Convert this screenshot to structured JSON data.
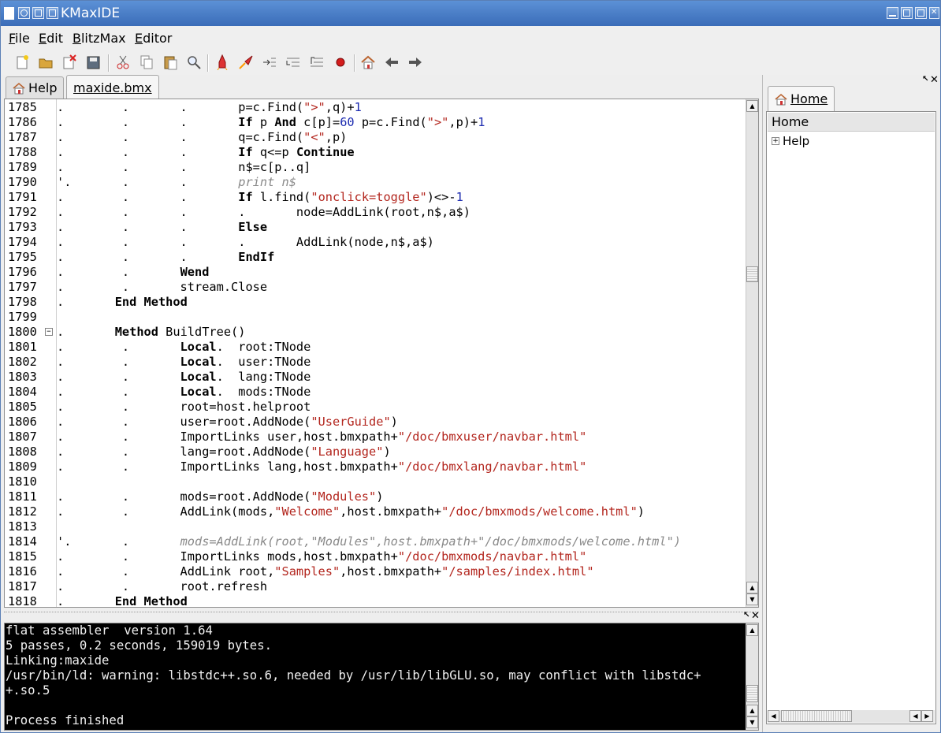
{
  "window": {
    "title": "KMaxIDE"
  },
  "menu": [
    "File",
    "Edit",
    "BlitzMax",
    "Editor"
  ],
  "menu_mnemonic": [
    "F",
    "E",
    "B",
    "E"
  ],
  "toolbar": {
    "icons": [
      "new-file-icon",
      "open-file-icon",
      "close-file-icon",
      "save-file-icon",
      "cut-icon",
      "copy-icon",
      "paste-icon",
      "find-icon",
      "build-icon",
      "build-run-icon",
      "step-icon",
      "step-in-icon",
      "step-out-icon",
      "stop-icon",
      "home-icon",
      "back-icon",
      "forward-icon"
    ]
  },
  "tabs": [
    {
      "label": "Help",
      "icon": "home-icon"
    },
    {
      "label": "maxide.bmx"
    }
  ],
  "editor": {
    "lines": [
      {
        "n": "1785",
        "html": "<span>.        .       .       p=c.Find(<span class='str'>\">\"</span>,q)+<span class='num'>1</span></span>"
      },
      {
        "n": "1786",
        "html": ".        .       .       <b>If</b> p <b>And</b> c[p]=<span class='num'>60</span> p=c.Find(<span class='str'>\">\"</span>,p)+<span class='num'>1</span>"
      },
      {
        "n": "1787",
        "html": ".        .       .       q=c.Find(<span class='str'>\"&lt;\"</span>,p)"
      },
      {
        "n": "1788",
        "html": ".        .       .       <b>If</b> q&lt;=p <b>Continue</b>"
      },
      {
        "n": "1789",
        "html": ".        .       .       n$=c[p..q]"
      },
      {
        "n": "1790",
        "html": "'.       .       .       <span class='cmt'>print n$</span>"
      },
      {
        "n": "1791",
        "html": ".        .       .       <b>If</b> l.find(<span class='str'>\"onclick=toggle\"</span>)&lt;&gt;-<span class='num'>1</span>"
      },
      {
        "n": "1792",
        "html": ".        .       .       .       node=AddLink(root,n$,a$)"
      },
      {
        "n": "1793",
        "html": ".        .       .       <b>Else</b>"
      },
      {
        "n": "1794",
        "html": ".        .       .       .       AddLink(node,n$,a$)"
      },
      {
        "n": "1795",
        "html": ".        .       .       <b>EndIf</b>"
      },
      {
        "n": "1796",
        "html": ".        .       <b>Wend</b>"
      },
      {
        "n": "1797",
        "html": ".        .       stream.Close"
      },
      {
        "n": "1798",
        "html": ".       <b>End Method</b>"
      },
      {
        "n": "1799",
        "html": ""
      },
      {
        "n": "1800",
        "html": ".       <b>Method</b> BuildTree()",
        "fold": true
      },
      {
        "n": "1801",
        "html": ".        .       <b>Local</b>.  root:TNode"
      },
      {
        "n": "1802",
        "html": ".        .       <b>Local</b>.  user:TNode"
      },
      {
        "n": "1803",
        "html": ".        .       <b>Local</b>.  lang:TNode"
      },
      {
        "n": "1804",
        "html": ".        .       <b>Local</b>.  mods:TNode"
      },
      {
        "n": "1805",
        "html": ".        .       root=host.helproot"
      },
      {
        "n": "1806",
        "html": ".        .       user=root.AddNode(<span class='str'>\"UserGuide\"</span>)"
      },
      {
        "n": "1807",
        "html": ".        .       ImportLinks user,host.bmxpath+<span class='str'>\"/doc/bmxuser/navbar.html\"</span>"
      },
      {
        "n": "1808",
        "html": ".        .       lang=root.AddNode(<span class='str'>\"Language\"</span>)"
      },
      {
        "n": "1809",
        "html": ".        .       ImportLinks lang,host.bmxpath+<span class='str'>\"/doc/bmxlang/navbar.html\"</span>"
      },
      {
        "n": "1810",
        "html": ""
      },
      {
        "n": "1811",
        "html": ".        .       mods=root.AddNode(<span class='str'>\"Modules\"</span>)"
      },
      {
        "n": "1812",
        "html": ".        .       AddLink(mods,<span class='str'>\"Welcome\"</span>,host.bmxpath+<span class='str'>\"/doc/bmxmods/welcome.html\"</span>)"
      },
      {
        "n": "1813",
        "html": ""
      },
      {
        "n": "1814",
        "html": "'.       .       <span class='cmt'>mods=AddLink(root,\"Modules\",host.bmxpath+\"/doc/bmxmods/welcome.html\")</span>"
      },
      {
        "n": "1815",
        "html": ".        .       ImportLinks mods,host.bmxpath+<span class='str'>\"/doc/bmxmods/navbar.html\"</span>"
      },
      {
        "n": "1816",
        "html": ".        .       AddLink root,<span class='str'>\"Samples\"</span>,host.bmxpath+<span class='str'>\"/samples/index.html\"</span>"
      },
      {
        "n": "1817",
        "html": ".        .       root.refresh"
      },
      {
        "n": "1818",
        "html": ".       <b>End Method</b>"
      }
    ]
  },
  "console": {
    "lines": [
      "flat assembler  version 1.64",
      "5 passes, 0.2 seconds, 159019 bytes.",
      "Linking:maxide",
      "/usr/bin/ld: warning: libstdc++.so.6, needed by /usr/lib/libGLU.so, may conflict with libstdc+",
      "+.so.5",
      "",
      "Process finished"
    ]
  },
  "right_panel": {
    "tab": "Home",
    "tree_header": "Home",
    "tree_items": [
      "Help"
    ]
  },
  "colors": {
    "title_bar": "#4a7ec8",
    "string": "#b3261e",
    "number": "#1c2bb0",
    "comment": "#8a8a8a",
    "console_bg": "#000000"
  }
}
